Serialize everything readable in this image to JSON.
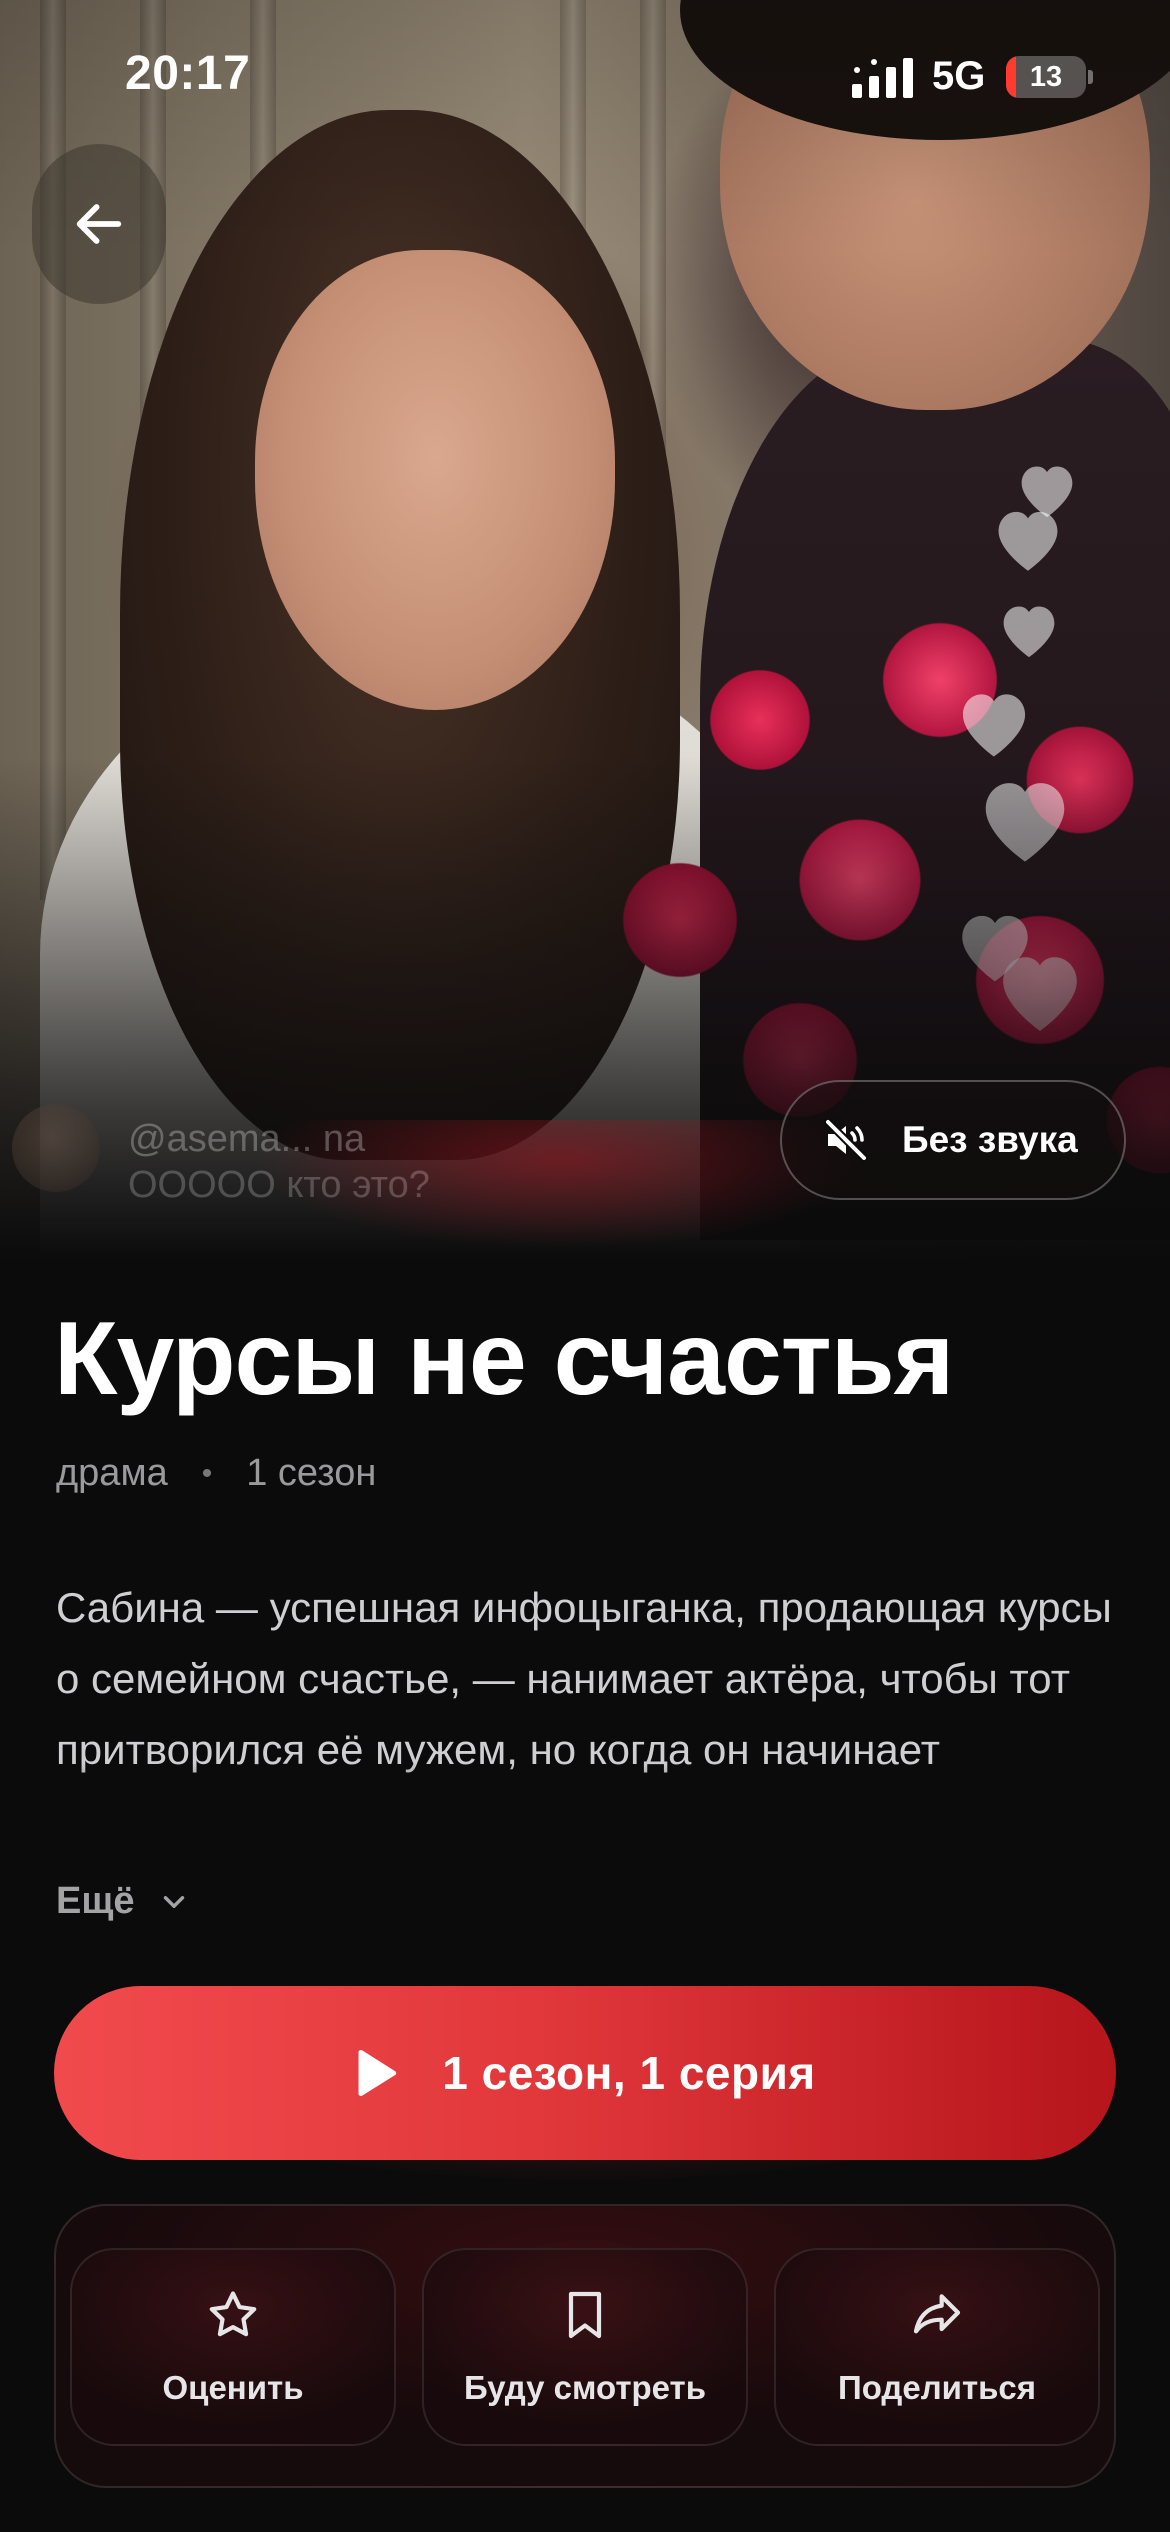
{
  "status_bar": {
    "time": "20:17",
    "network": "5G",
    "battery_level": 13,
    "battery_text": "13",
    "battery_color": "#ff3b30"
  },
  "video": {
    "back_icon": "arrow-left-icon",
    "comment": {
      "user": "@asema... na",
      "text": "OOOOO кто это?"
    },
    "mute": {
      "icon": "speaker-muted-icon",
      "label": "Без звука"
    }
  },
  "show": {
    "title": "Курсы не счастья",
    "genre": "драма",
    "separator": "•",
    "seasons": "1 сезон",
    "description": "Сабина — успешная инфоцыганка, продающая курсы о семейном счастье, — нанимает актёра, чтобы тот притворился её мужем, но когда он начинает",
    "more_label": "Ещё"
  },
  "play": {
    "icon": "play-icon",
    "label": "1 сезон, 1 серия",
    "color": "#e2383c"
  },
  "actions": [
    {
      "icon": "star-icon",
      "label": "Оценить"
    },
    {
      "icon": "bookmark-icon",
      "label": "Буду смотреть"
    },
    {
      "icon": "share-icon",
      "label": "Поделиться"
    }
  ]
}
